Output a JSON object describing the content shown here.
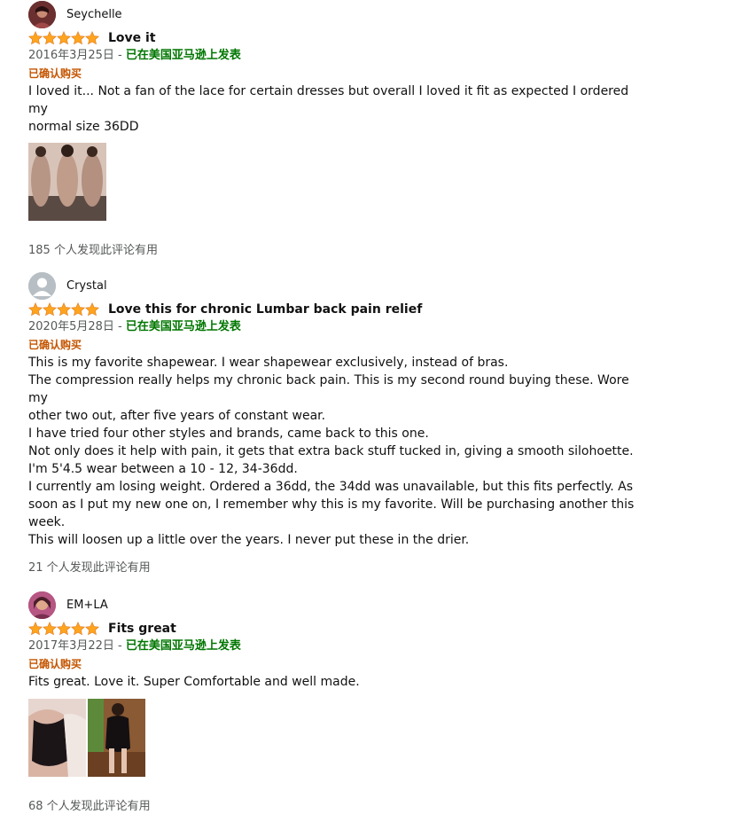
{
  "reviews": [
    {
      "author": "Seychelle",
      "rating": 5,
      "title": "Love it",
      "date": "2016年3月25日",
      "separator": " - ",
      "site": "已在美国亚马逊上发表",
      "verified": "已确认购买",
      "body": [
        "I loved it... Not a fan of the lace for certain dresses but overall I loved it fit as expected I ordered my",
        "normal size 36DD"
      ],
      "photo_count": 1,
      "helpful": "185 个人发现此评论有用"
    },
    {
      "author": "Crystal",
      "rating": 5,
      "title": "Love this for chronic Lumbar back pain relief",
      "date": "2020年5月28日",
      "separator": " - ",
      "site": "已在美国亚马逊上发表",
      "verified": "已确认购买",
      "body": [
        "This is my favorite shapewear. I wear shapewear exclusively, instead of bras.",
        "The compression really helps my chronic back pain. This is my second round buying these. Wore my",
        "other two out, after five years of constant wear.",
        "I have tried four other styles and brands, came back to this one.",
        "Not only does it help with pain, it gets that extra back stuff tucked in, giving a smooth silohoette.",
        "I'm 5'4.5 wear between a 10 - 12, 34-36dd.",
        "I currently am losing weight. Ordered a 36dd, the 34dd was unavailable, but this fits perfectly. As",
        "soon as I put my new one on, I remember why this is my favorite. Will be purchasing another this",
        "week.",
        "This will loosen up a little over the years. I never put these in the drier."
      ],
      "photo_count": 0,
      "helpful": "21 个人发现此评论有用"
    },
    {
      "author": "EM+LA",
      "rating": 5,
      "title": "Fits great",
      "date": "2017年3月22日",
      "separator": " - ",
      "site": "已在美国亚马逊上发表",
      "verified": "已确认购买",
      "body": [
        "Fits great. Love it. Super Comfortable and well made."
      ],
      "photo_count": 2,
      "helpful": "68 个人发现此评论有用"
    }
  ],
  "colors": {
    "star": "#ffa41c",
    "site_link": "#007600",
    "verified": "#c45500",
    "meta": "#565959"
  },
  "icons": {
    "star": "star-icon",
    "avatar_default": "default-avatar-icon"
  }
}
